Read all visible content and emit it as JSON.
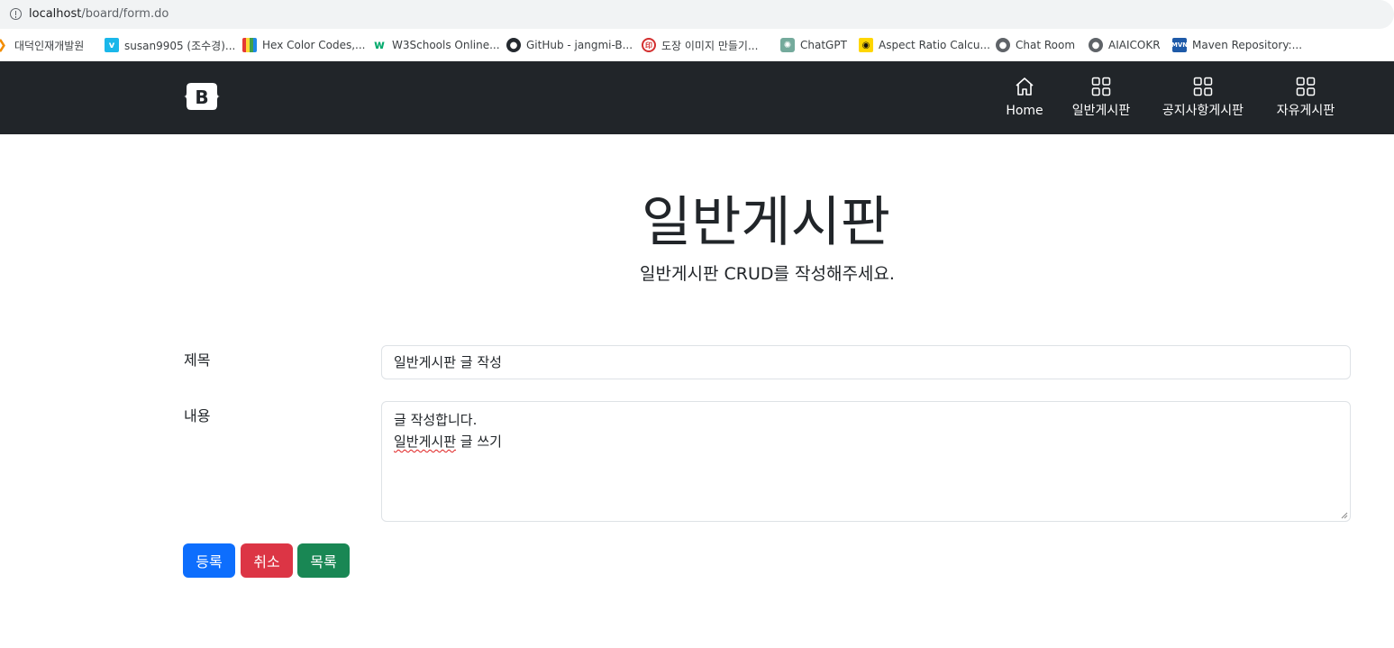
{
  "browser": {
    "url_host": "localhost",
    "url_path": "/board/form.do"
  },
  "bookmarks": [
    {
      "label": "대덕인재개발원",
      "icon": "feather-icon"
    },
    {
      "label": "susan9905 (조수경)...",
      "icon": "vimeo-icon"
    },
    {
      "label": "Hex Color Codes,...",
      "icon": "color-book-icon"
    },
    {
      "label": "W3Schools Online...",
      "icon": "w3schools-icon"
    },
    {
      "label": "GitHub - jangmi-B...",
      "icon": "github-icon"
    },
    {
      "label": "도장 이미지 만들기...",
      "icon": "stamp-icon"
    },
    {
      "label": "ChatGPT",
      "icon": "chatgpt-icon"
    },
    {
      "label": "Aspect Ratio Calcu...",
      "icon": "aspect-ratio-icon"
    },
    {
      "label": "Chat Room",
      "icon": "globe-icon"
    },
    {
      "label": "AIAICOKR",
      "icon": "globe-icon"
    },
    {
      "label": "Maven Repository:...",
      "icon": "maven-icon"
    }
  ],
  "navbar": {
    "brand_icon": "bootstrap-logo",
    "items": [
      {
        "label": "Home",
        "icon": "home-icon"
      },
      {
        "label": "일반게시판",
        "icon": "grid-icon"
      },
      {
        "label": "공지사항게시판",
        "icon": "grid-icon"
      },
      {
        "label": "자유게시판",
        "icon": "grid-icon"
      }
    ]
  },
  "header": {
    "title": "일반게시판",
    "subtitle": "일반게시판 CRUD를 작성해주세요."
  },
  "form": {
    "title_label": "제목",
    "title_value": "일반게시판 글 작성",
    "content_label": "내용",
    "content_line1": "글 작성합니다.",
    "content_line2_misspelled": "일반게시판",
    "content_line2_rest": " 글 쓰기"
  },
  "buttons": {
    "submit": "등록",
    "cancel": "취소",
    "list": "목록"
  },
  "colors": {
    "navbar_bg": "#212529",
    "primary": "#0d6efd",
    "danger": "#dc3545",
    "success": "#198754"
  }
}
